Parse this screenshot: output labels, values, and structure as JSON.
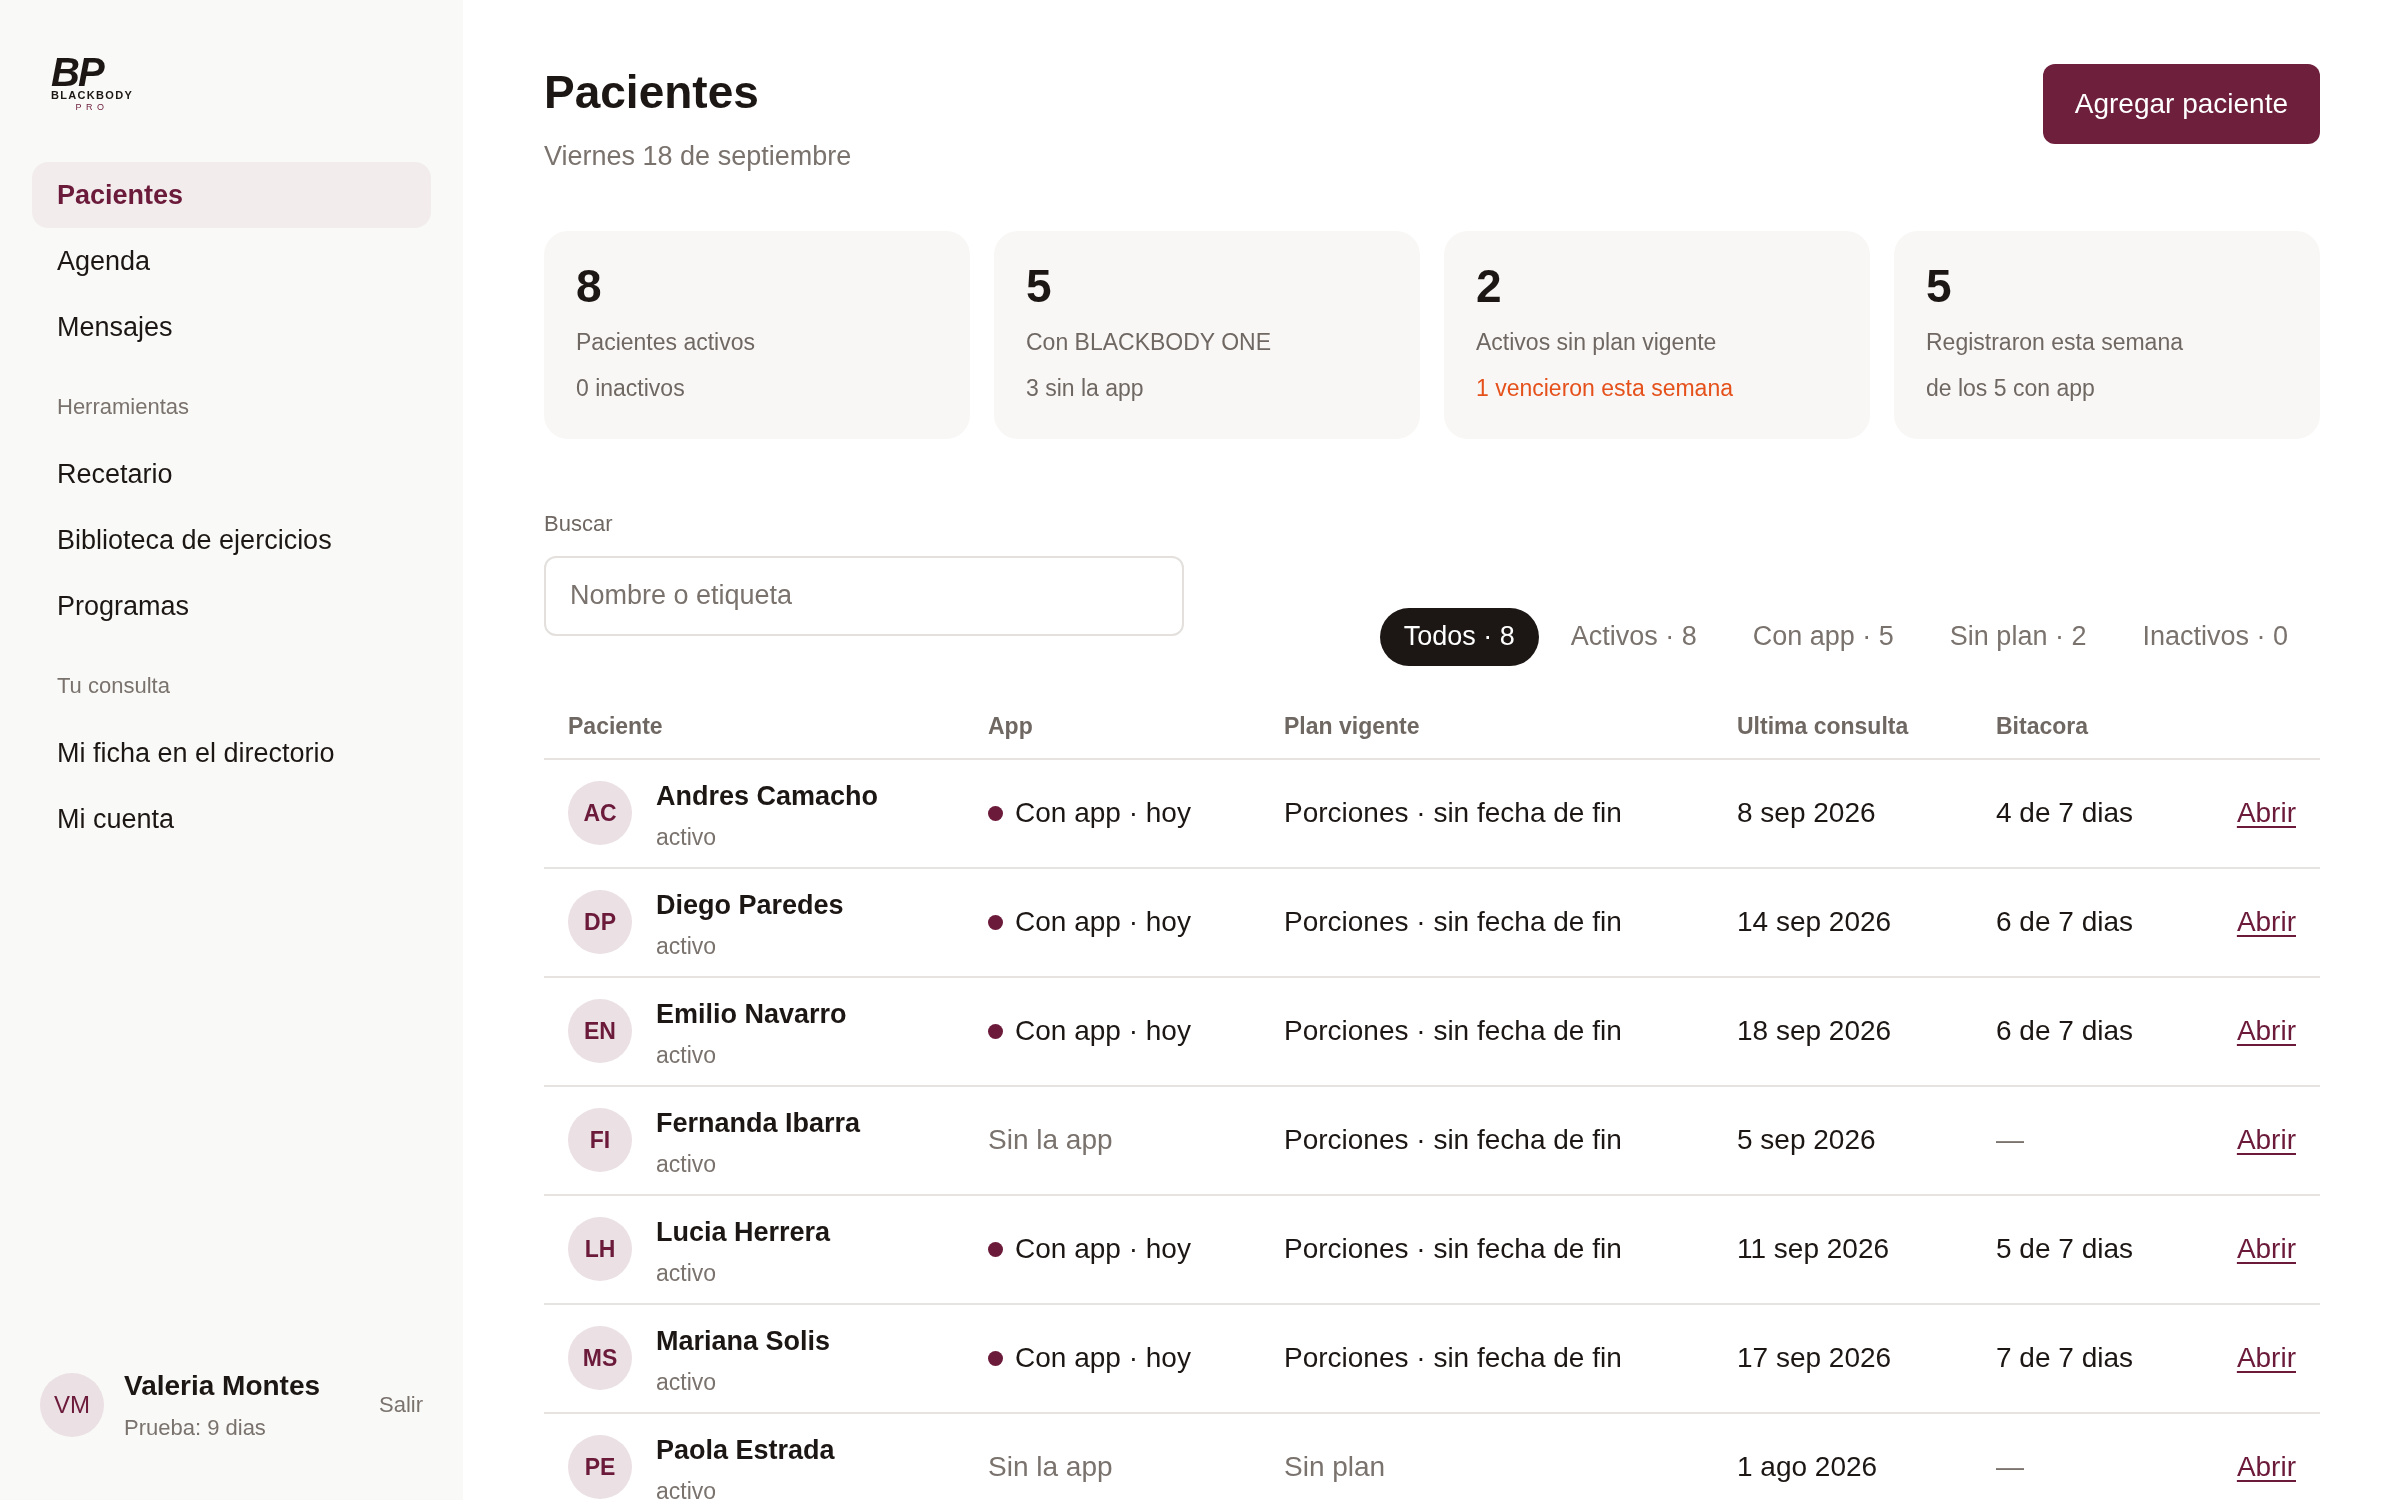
{
  "logo": {
    "mark": "BP",
    "name": "BLACKBODY",
    "sub": "PRO"
  },
  "sidebar": {
    "groups": [
      {
        "items": [
          {
            "label": "Pacientes",
            "selected": true
          },
          {
            "label": "Agenda",
            "selected": false
          },
          {
            "label": "Mensajes",
            "selected": false
          }
        ]
      },
      {
        "heading": "Herramientas",
        "items": [
          {
            "label": "Recetario",
            "selected": false
          },
          {
            "label": "Biblioteca de ejercicios",
            "selected": false
          },
          {
            "label": "Programas",
            "selected": false
          }
        ]
      },
      {
        "heading": "Tu consulta",
        "items": [
          {
            "label": "Mi ficha en el directorio",
            "selected": false
          },
          {
            "label": "Mi cuenta",
            "selected": false
          }
        ]
      }
    ],
    "user": {
      "initials": "VM",
      "name": "Valeria Montes",
      "plan": "Prueba: 9 dias",
      "logout": "Salir"
    }
  },
  "header": {
    "title": "Pacientes",
    "date": "Viernes 18 de septiembre",
    "button": "Agregar paciente"
  },
  "stats": [
    {
      "value": "8",
      "label": "Pacientes activos",
      "note": "0 inactivos",
      "alert": false
    },
    {
      "value": "5",
      "label": "Con BLACKBODY ONE",
      "note": "3 sin la app",
      "alert": false
    },
    {
      "value": "2",
      "label": "Activos sin plan vigente",
      "note": "1 vencieron esta semana",
      "alert": true
    },
    {
      "value": "5",
      "label": "Registraron esta semana",
      "note": "de los 5 con app",
      "alert": false
    }
  ],
  "search": {
    "label": "Buscar",
    "placeholder": "Nombre o etiqueta"
  },
  "filters": [
    {
      "label": "Todos · 8",
      "selected": true
    },
    {
      "label": "Activos · 8",
      "selected": false
    },
    {
      "label": "Con app · 5",
      "selected": false
    },
    {
      "label": "Sin plan · 2",
      "selected": false
    },
    {
      "label": "Inactivos · 0",
      "selected": false
    }
  ],
  "table": {
    "columns": [
      "Paciente",
      "App",
      "Plan vigente",
      "Ultima consulta",
      "Bitacora"
    ],
    "rows": [
      {
        "initials": "AC",
        "name": "Andres Camacho",
        "status": "activo",
        "app": "Con app · hoy",
        "app_on": true,
        "plan": "Porciones · sin fecha de fin",
        "plan_on": true,
        "last": "8 sep 2026",
        "log": "4 de 7 dias",
        "action": "Abrir"
      },
      {
        "initials": "DP",
        "name": "Diego Paredes",
        "status": "activo",
        "app": "Con app · hoy",
        "app_on": true,
        "plan": "Porciones · sin fecha de fin",
        "plan_on": true,
        "last": "14 sep 2026",
        "log": "6 de 7 dias",
        "action": "Abrir"
      },
      {
        "initials": "EN",
        "name": "Emilio Navarro",
        "status": "activo",
        "app": "Con app · hoy",
        "app_on": true,
        "plan": "Porciones · sin fecha de fin",
        "plan_on": true,
        "last": "18 sep 2026",
        "log": "6 de 7 dias",
        "action": "Abrir"
      },
      {
        "initials": "FI",
        "name": "Fernanda Ibarra",
        "status": "activo",
        "app": "Sin la app",
        "app_on": false,
        "plan": "Porciones · sin fecha de fin",
        "plan_on": true,
        "last": "5 sep 2026",
        "log": "—",
        "action": "Abrir"
      },
      {
        "initials": "LH",
        "name": "Lucia Herrera",
        "status": "activo",
        "app": "Con app · hoy",
        "app_on": true,
        "plan": "Porciones · sin fecha de fin",
        "plan_on": true,
        "last": "11 sep 2026",
        "log": "5 de 7 dias",
        "action": "Abrir"
      },
      {
        "initials": "MS",
        "name": "Mariana Solis",
        "status": "activo",
        "app": "Con app · hoy",
        "app_on": true,
        "plan": "Porciones · sin fecha de fin",
        "plan_on": true,
        "last": "17 sep 2026",
        "log": "7 de 7 dias",
        "action": "Abrir"
      },
      {
        "initials": "PE",
        "name": "Paola Estrada",
        "status": "activo",
        "app": "Sin la app",
        "app_on": false,
        "plan": "Sin plan",
        "plan_on": false,
        "last": "1 ago 2026",
        "log": "—",
        "action": "Abrir"
      }
    ]
  }
}
